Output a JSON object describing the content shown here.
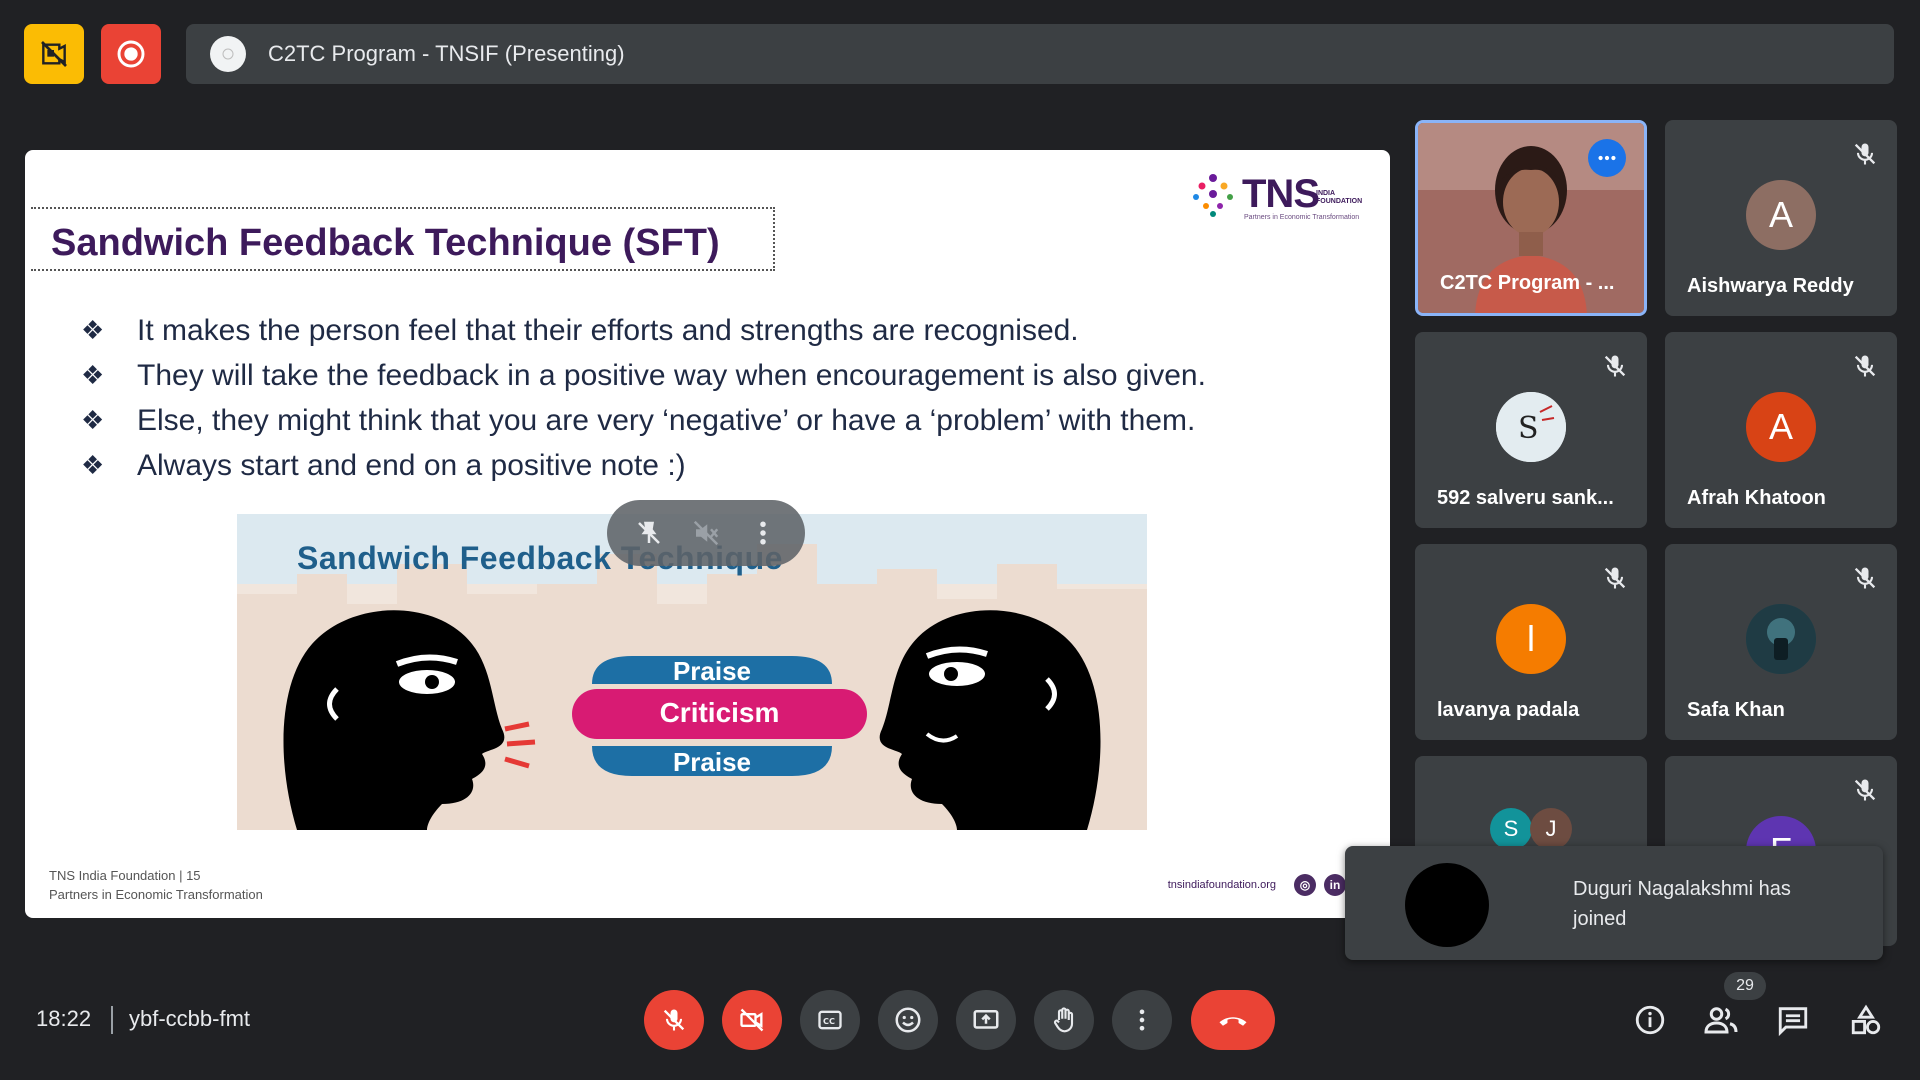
{
  "meeting": {
    "title": "C2TC Program - TNSIF (Presenting)",
    "time": "18:22",
    "code": "ybf-ccbb-fmt",
    "participant_count": "29"
  },
  "slide": {
    "heading": "Sandwich Feedback Technique (SFT)",
    "bullets": [
      "It makes the person feel that their efforts and strengths are recognised.",
      "They will take the feedback in a positive way when encouragement is also given.",
      "Else, they might think that you are very ‘negative’ or have a ‘problem’ with them.",
      "Always start and end on a positive note :)"
    ],
    "bullet_marker": "❖",
    "logo_text": "TNS",
    "logo_small": "INDIA\nFOUNDATION",
    "logo_tagline": "Partners in Economic Transformation",
    "footer_line1": "TNS India Foundation | 15",
    "footer_line2": "Partners in Economic Transformation",
    "footer_url": "tnsindiafoundation.org",
    "illustration": {
      "title": "Sandwich Feedback Technique",
      "top": "Praise",
      "middle": "Criticism",
      "bottom": "Praise"
    }
  },
  "participants": [
    {
      "name": "C2TC Program - ...",
      "initial": "",
      "color": "#8e5f58"
    },
    {
      "name": "Aishwarya Reddy",
      "initial": "A",
      "color": "#8d6e63"
    },
    {
      "name": "592 salveru sank...",
      "initial": "",
      "color": "#dfe6ea"
    },
    {
      "name": "Afrah Khatoon",
      "initial": "A",
      "color": "#d84315"
    },
    {
      "name": "lavanya padala",
      "initial": "l",
      "color": "#f57c00"
    },
    {
      "name": "Safa Khan",
      "initial": "",
      "color": "#2a4a54"
    },
    {
      "name": "",
      "initial": "S",
      "color": "#12939a",
      "initial2": "J",
      "color2": "#6d4c41"
    },
    {
      "name": "",
      "initial": "F",
      "color": "#5e35b1"
    }
  ],
  "toast": {
    "message": "Duguri Nagalakshmi has joined"
  },
  "colors": {
    "accent_red": "#ea4335",
    "warning_yellow": "#fbbc04",
    "background": "#202124",
    "surface": "#3c4043",
    "active_border": "#8ab4f8"
  }
}
